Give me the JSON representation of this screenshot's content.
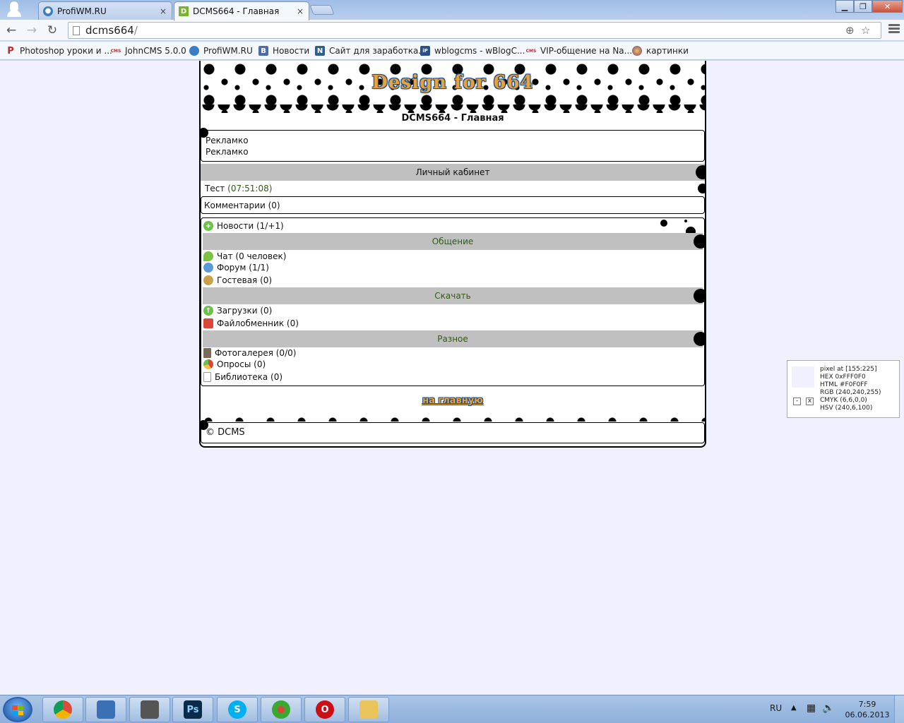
{
  "browser": {
    "tabs": [
      {
        "label": "ProfiWM.RU",
        "icon": "wm-globe-icon",
        "close": "×"
      },
      {
        "label": "DCMS664 - Главная",
        "icon": "dcms-d-icon",
        "icon_text": "D",
        "close": "×"
      }
    ],
    "url_host": "dcms664",
    "url_path": "/",
    "bookmarks": [
      {
        "label": "Photoshop уроки и ...",
        "icon": "photoshop-p-icon",
        "icon_text": "P"
      },
      {
        "label": "JohnCMS 5.0.0",
        "icon": "cms-icon",
        "icon_text": "CMS"
      },
      {
        "label": "ProfiWM.RU",
        "icon": "wm-globe-icon"
      },
      {
        "label": "Новости",
        "icon": "vk-icon",
        "icon_text": "B"
      },
      {
        "label": "Сайт для заработка...",
        "icon": "n-icon",
        "icon_text": "N"
      },
      {
        "label": "wblogcms - wBlogC...",
        "icon": "house-icon",
        "icon_text": "iP"
      },
      {
        "label": "VIP-общение на Na...",
        "icon": "cms-icon",
        "icon_text": "CMS"
      },
      {
        "label": "картинки",
        "icon": "pictures-icon"
      }
    ]
  },
  "site": {
    "logo": "Design for 664",
    "title": "DCMS664 - Главная",
    "ads": [
      "Рекламко",
      "Рекламко"
    ],
    "cabinet_header": "Личный кабинет",
    "user_name": "Тест",
    "user_time": "(07:51:08)",
    "comments": "Комментарии (0)",
    "news": "Новости (1/+1)",
    "sections": [
      {
        "header": "Общение",
        "items": [
          {
            "label": "Чат (0 человек)",
            "icon": "chat-bubble-icon"
          },
          {
            "label": "Форум (1/1)",
            "icon": "forum-icon"
          },
          {
            "label": "Гостевая (0)",
            "icon": "guestbook-icon"
          }
        ]
      },
      {
        "header": "Скачать",
        "items": [
          {
            "label": "Загрузки (0)",
            "icon": "download-arrow-icon"
          },
          {
            "label": "Файлобменник (0)",
            "icon": "folder-icon"
          }
        ]
      },
      {
        "header": "Разное",
        "items": [
          {
            "label": "Фотогалерея (0/0)",
            "icon": "photo-icon"
          },
          {
            "label": "Опросы (0)",
            "icon": "poll-chart-icon"
          },
          {
            "label": "Библиотека (0)",
            "icon": "document-icon"
          }
        ]
      }
    ],
    "home_link": "на главную",
    "copyright": "© DCMS"
  },
  "picker": {
    "lines": [
      "pixel at [155:225]",
      "HEX 0xFFF0F0",
      "HTML #F0F0FF",
      "RGB (240,240,255)",
      "CMYK (6,6,0,0)",
      "HSV (240,6,100)"
    ],
    "minimize": "-",
    "close": "x",
    "swatch_color": "#f0f0ff"
  },
  "taskbar": {
    "apps": [
      {
        "name": "chrome-icon",
        "color": "#dd4b39"
      },
      {
        "name": "drawing-app-icon",
        "color": "#3b6fb6"
      },
      {
        "name": "pen-tool-icon",
        "color": "#555555"
      },
      {
        "name": "photoshop-icon",
        "color": "#0a2a4a",
        "text": "Ps"
      },
      {
        "name": "skype-icon",
        "color": "#00aff0",
        "text": "S"
      },
      {
        "name": "icq-flower-icon",
        "color": "#3aa932"
      },
      {
        "name": "opera-icon",
        "color": "#cc0f16",
        "text": "O"
      },
      {
        "name": "explorer-folder-icon",
        "color": "#e8c45a"
      }
    ],
    "lang": "RU",
    "time": "7:59",
    "date": "06.06.2013"
  },
  "colors": {
    "accent_orange": "#e8a23a",
    "accent_blue": "#1a4b8a",
    "page_bg": "#f0f0ff",
    "bar_gray": "#c0c0c0",
    "green_text": "#2f5c15"
  }
}
